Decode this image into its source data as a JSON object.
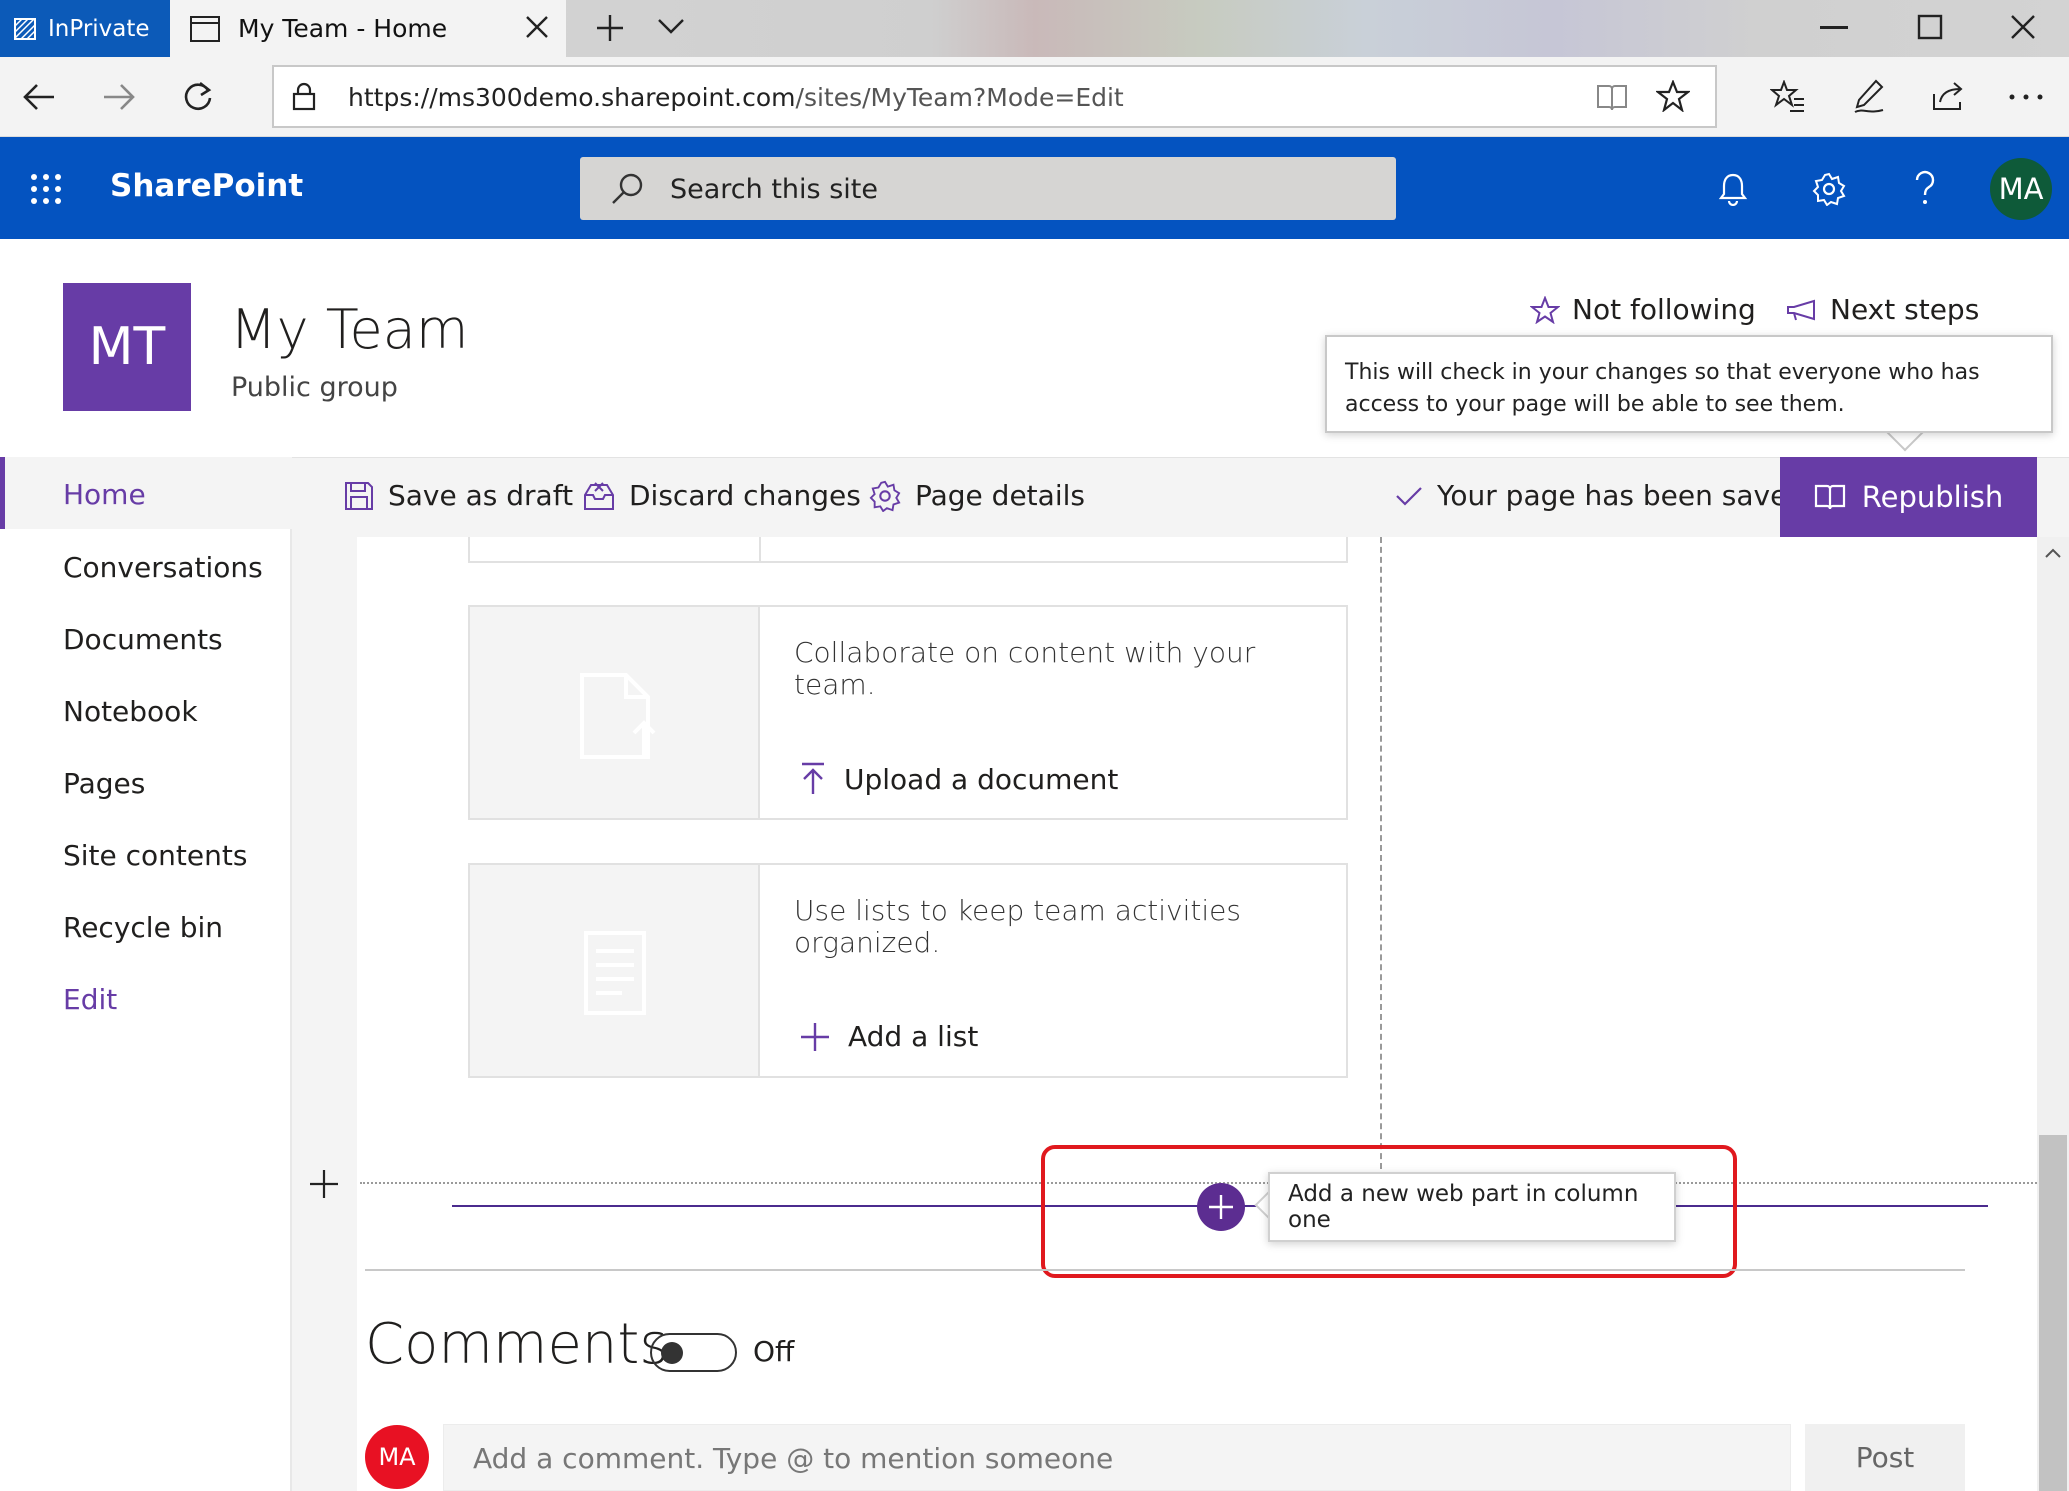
{
  "browser": {
    "inprivate_label": "InPrivate",
    "tab_title": "My Team - Home",
    "url_host": "https://ms300demo.sharepoint.com",
    "url_path": "/sites/MyTeam?Mode=Edit"
  },
  "suite": {
    "brand": "SharePoint",
    "search_placeholder": "Search this site",
    "avatar_initials": "MA"
  },
  "site": {
    "logo_initials": "MT",
    "title": "My Team",
    "subtitle": "Public group",
    "follow_label": "Not following",
    "next_steps_label": "Next steps"
  },
  "callout": {
    "text": "This will check in your changes so that everyone who has access to your page will be able to see them."
  },
  "nav": {
    "items": [
      "Home",
      "Conversations",
      "Documents",
      "Notebook",
      "Pages",
      "Site contents",
      "Recycle bin",
      "Edit"
    ]
  },
  "commandbar": {
    "save_draft": "Save as draft",
    "discard": "Discard changes",
    "page_details": "Page details",
    "saved_status": "Your page has been saved",
    "republish": "Republish"
  },
  "cards": [
    {
      "text": "Collaborate on content with your team.",
      "action": "Upload a document"
    },
    {
      "text": "Use lists to keep team activities organized.",
      "action": "Add a list"
    }
  ],
  "add_webpart": {
    "tooltip": "Add a new web part in column one"
  },
  "comments": {
    "title": "Comments",
    "toggle_state": "Off",
    "avatar_initials": "MA",
    "placeholder": "Add a comment. Type @ to mention someone",
    "post_label": "Post"
  },
  "colors": {
    "suite_blue": "#0453c0",
    "site_purple": "#673ca6",
    "highlight_red": "#e0191e"
  }
}
